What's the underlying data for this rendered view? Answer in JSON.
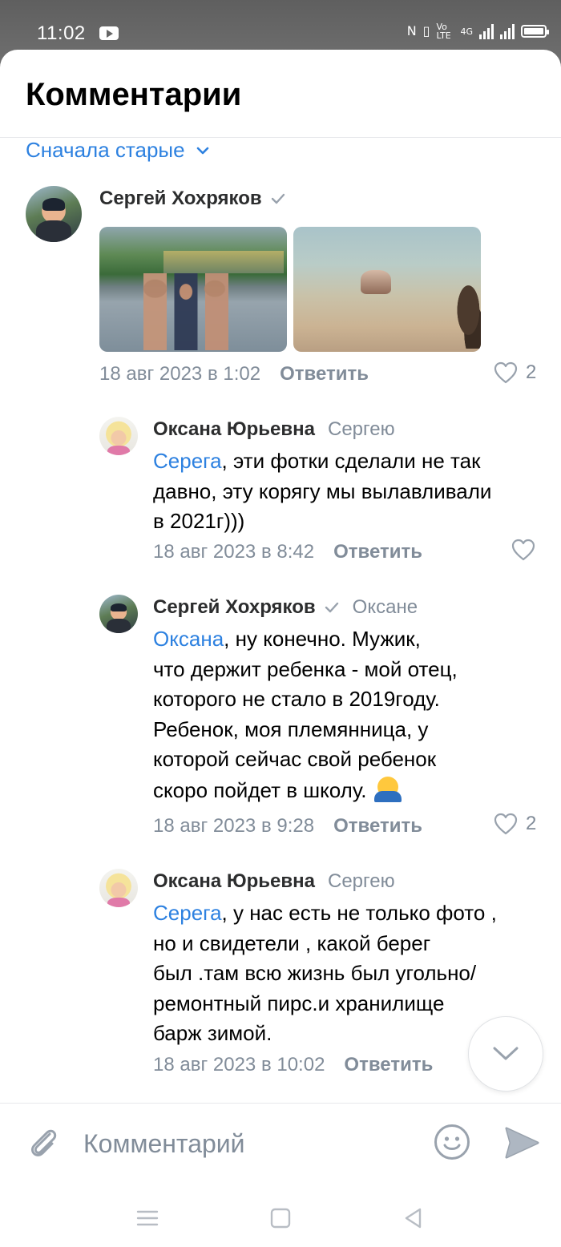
{
  "status_bar": {
    "time": "11:02",
    "network": "4G",
    "volte": "Vo LTE"
  },
  "header": {
    "title": "Комментарии"
  },
  "sort": {
    "label": "Сначала старые"
  },
  "comments": [
    {
      "author": "Сергей Хохряков",
      "verified": true,
      "date": "18 авг 2023 в 1:02",
      "reply_label": "Ответить",
      "likes": "2",
      "photos": [
        "photo-group-beach",
        "photo-shore-wading"
      ]
    },
    {
      "author": "Оксана Юрьевна",
      "reply_to": "Сергею",
      "mention": "Серега",
      "text_lines": [
        ", эти фотки сделали не так",
        "давно, эту корягу мы вылавливали",
        "в 2021г)))"
      ],
      "date": "18 авг 2023 в 8:42",
      "reply_label": "Ответить",
      "likes": ""
    },
    {
      "author": "Сергей Хохряков",
      "verified": true,
      "reply_to": "Оксане",
      "mention": "Оксана",
      "text_lines": [
        ", ну конечно. Мужик,",
        "что держит ребенка - мой отец,",
        "которого не стало в 2019году.",
        "Ребенок, моя племянница, у",
        "которой сейчас свой ребенок",
        "скоро пойдет в школу. "
      ],
      "date": "18 авг 2023 в 9:28",
      "reply_label": "Ответить",
      "likes": "2"
    },
    {
      "author": "Оксана Юрьевна",
      "reply_to": "Сергею",
      "mention": "Серега",
      "text_lines": [
        ", у нас есть не только фото ,",
        "но и свидетели , какой берег",
        "был .там всю жизнь был угольно/",
        "ремонтный пирс.и хранилище",
        "барж зимой."
      ],
      "date": "18 авг 2023 в 10:02",
      "reply_label": "Ответить"
    }
  ],
  "composer": {
    "placeholder": "Комментарий"
  },
  "colors": {
    "accent": "#2d81e0",
    "secondary_text": "#818c99",
    "icon_gray": "#99a2ad"
  },
  "icons": [
    "attach-icon",
    "emoji-icon",
    "send-icon",
    "heart-icon",
    "verified-icon",
    "chevron-down-icon",
    "menu-icon",
    "home-icon",
    "back-icon"
  ]
}
